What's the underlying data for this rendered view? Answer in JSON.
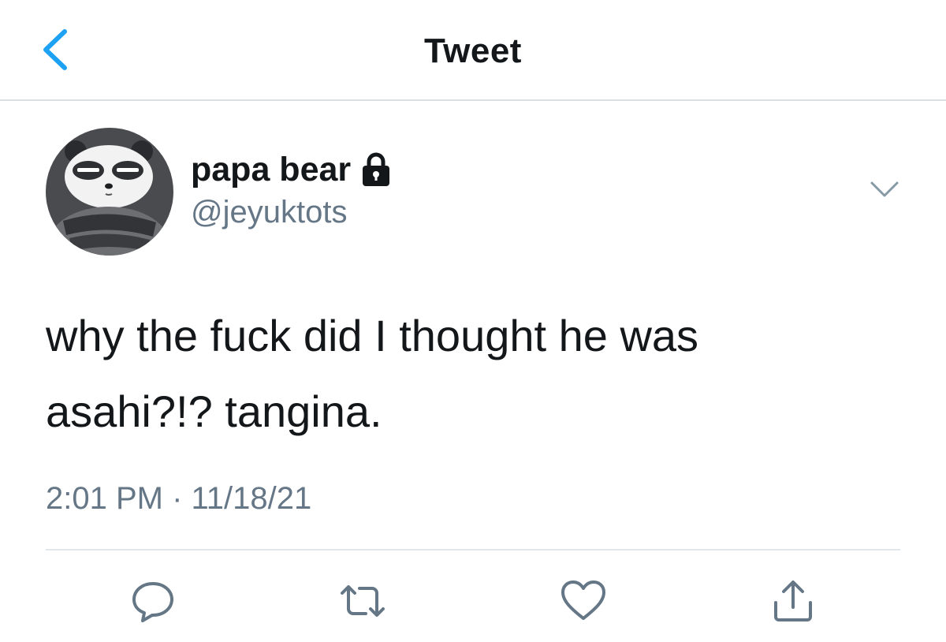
{
  "nav": {
    "title": "Tweet",
    "back_icon": "chevron-left-icon"
  },
  "author": {
    "display_name": "papa bear",
    "handle": "@jeyuktots",
    "protected_icon": "lock-icon",
    "avatar": "panda-avatar"
  },
  "tweet": {
    "text_line1": "why the fuck did I thought he was",
    "text_line2": "asahi?!? tangina.",
    "timestamp": "2:01 PM · 11/18/21"
  },
  "actions": {
    "reply_icon": "reply-icon",
    "retweet_icon": "retweet-icon",
    "like_icon": "heart-icon",
    "share_icon": "share-icon"
  },
  "colors": {
    "accent": "#1da1f2",
    "secondary_text": "#657786",
    "primary_text": "#14171a",
    "divider": "#e1e6ea"
  }
}
